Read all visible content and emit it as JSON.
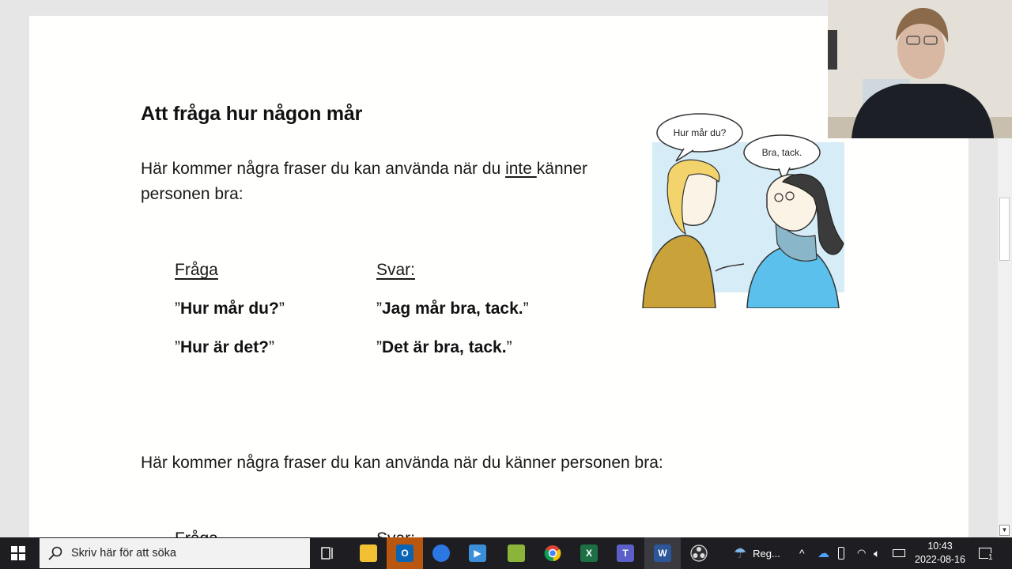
{
  "document": {
    "heading": "Att fråga hur någon mår",
    "para1_before": "Här kommer några fraser du kan använda när du ",
    "para1_underlined": "inte ",
    "para1_after": "känner personen bra:",
    "col_question": "Fråga",
    "col_answer": "Svar:",
    "row1_question": "Hur mår du?",
    "row1_answer": "Jag mår bra, tack.",
    "row2_question": "Hur är det?",
    "row2_answer": "Det är bra, tack.",
    "quote_open": "”",
    "quote_close": "”",
    "para2": "Här kommer några fraser du kan använda när du känner personen bra:",
    "cut_left": "Fråga",
    "cut_right": "Svar:"
  },
  "illustration": {
    "bubble_left": "Hur mår du?",
    "bubble_right": "Bra, tack."
  },
  "taskbar": {
    "search_placeholder": "Skriv här för att söka",
    "weather_label": "Reg...",
    "time": "10:43",
    "date": "2022-08-16",
    "notification_count": "1",
    "apps": [
      "task-view",
      "file-explorer",
      "outlook",
      "app-blue-circle",
      "media-app",
      "game-app",
      "chrome",
      "excel",
      "teams",
      "word",
      "obs"
    ]
  },
  "colors": {
    "taskbar_bg": "#1e1e22",
    "page_bg": "#fffffe",
    "outlook_highlight": "#b9560f"
  }
}
